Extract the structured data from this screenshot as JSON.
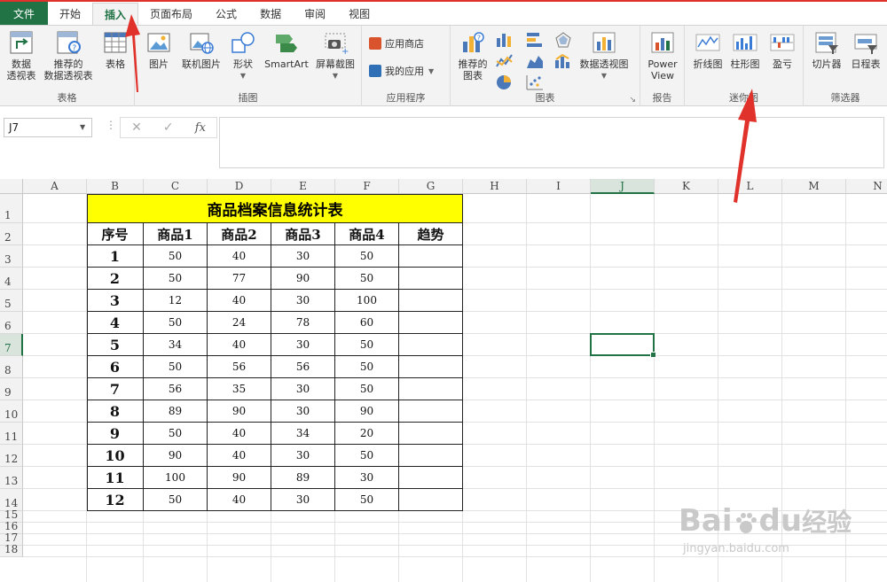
{
  "tabs": {
    "file": "文件",
    "items": [
      "开始",
      "插入",
      "页面布局",
      "公式",
      "数据",
      "审阅",
      "视图"
    ],
    "active": "插入"
  },
  "ribbon": {
    "tables": {
      "label": "表格",
      "pivot_l1": "数据",
      "pivot_l2": "透视表",
      "rec_pivot_l1": "推荐的",
      "rec_pivot_l2": "数据透视表",
      "table": "表格"
    },
    "illustrations": {
      "label": "插图",
      "picture": "图片",
      "online_picture": "联机图片",
      "shapes": "形状",
      "smartart": "SmartArt",
      "screenshot": "屏幕截图"
    },
    "apps": {
      "label": "应用程序",
      "store": "应用商店",
      "my_apps": "我的应用"
    },
    "charts": {
      "label": "图表",
      "rec_chart_l1": "推荐的",
      "rec_chart_l2": "图表",
      "pivot_chart": "数据透视图"
    },
    "reports": {
      "label": "报告",
      "power_view_l1": "Power",
      "power_view_l2": "View"
    },
    "sparklines": {
      "label": "迷你图",
      "line": "折线图",
      "column": "柱形图",
      "win_loss": "盈亏"
    },
    "filters": {
      "label": "筛选器",
      "slicer": "切片器",
      "timeline": "日程表"
    }
  },
  "formula_bar": {
    "name_box": "J7",
    "cancel": "✕",
    "enter": "✓",
    "fx": "fx",
    "value": ""
  },
  "columns": [
    "A",
    "B",
    "C",
    "D",
    "E",
    "F",
    "G",
    "H",
    "I",
    "J",
    "K",
    "L",
    "M",
    "N"
  ],
  "rows": [
    "1",
    "2",
    "3",
    "4",
    "5",
    "6",
    "7",
    "8",
    "9",
    "10",
    "11",
    "12",
    "13",
    "14",
    "15",
    "16",
    "17",
    "18"
  ],
  "selected_cell": "J7",
  "sheet": {
    "title": "商品档案信息统计表",
    "headers": [
      "序号",
      "商品1",
      "商品2",
      "商品3",
      "商品4",
      "趋势"
    ],
    "rows": [
      [
        "1",
        "50",
        "40",
        "30",
        "50",
        ""
      ],
      [
        "2",
        "50",
        "77",
        "90",
        "50",
        ""
      ],
      [
        "3",
        "12",
        "40",
        "30",
        "100",
        ""
      ],
      [
        "4",
        "50",
        "24",
        "78",
        "60",
        ""
      ],
      [
        "5",
        "34",
        "40",
        "30",
        "50",
        ""
      ],
      [
        "6",
        "50",
        "56",
        "56",
        "50",
        ""
      ],
      [
        "7",
        "56",
        "35",
        "30",
        "50",
        ""
      ],
      [
        "8",
        "89",
        "90",
        "30",
        "90",
        ""
      ],
      [
        "9",
        "50",
        "40",
        "34",
        "20",
        ""
      ],
      [
        "10",
        "90",
        "40",
        "30",
        "50",
        ""
      ],
      [
        "11",
        "100",
        "90",
        "89",
        "30",
        ""
      ],
      [
        "12",
        "50",
        "40",
        "30",
        "50",
        ""
      ]
    ]
  },
  "watermark": {
    "brand": "Bai",
    "brand2": "du",
    "cn": "经验",
    "url": "jingyan.baidu.com"
  },
  "colors": {
    "excel_green": "#217346",
    "title_fill": "#ffff00",
    "arrow_red": "#e0322a"
  }
}
